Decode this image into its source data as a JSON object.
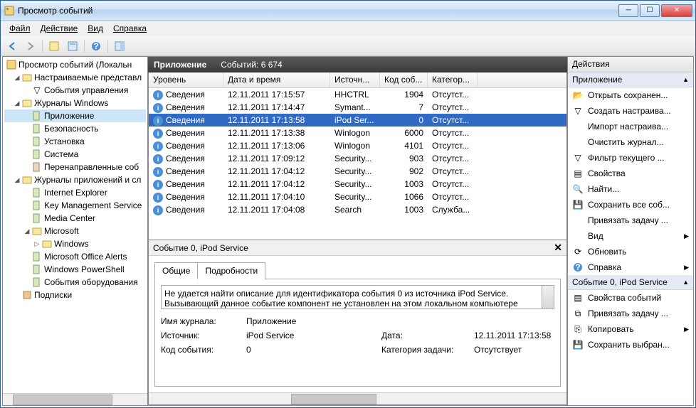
{
  "title": "Просмотр событий",
  "menu": {
    "file": "Файл",
    "action": "Действие",
    "view": "Вид",
    "help": "Справка"
  },
  "tree": {
    "root": "Просмотр событий (Локальн",
    "custom_views": "Настраиваемые представл",
    "admin_events": "События управления",
    "win_logs": "Журналы Windows",
    "application": "Приложение",
    "security": "Безопасность",
    "setup": "Установка",
    "system": "Система",
    "forwarded": "Перенаправленные соб",
    "app_logs": "Журналы приложений и сл",
    "ie": "Internet Explorer",
    "kms": "Key Management Service",
    "mc": "Media Center",
    "ms": "Microsoft",
    "windows": "Windows",
    "office": "Microsoft Office Alerts",
    "ps": "Windows PowerShell",
    "hw": "События оборудования",
    "subs": "Подписки"
  },
  "center": {
    "title": "Приложение",
    "count_label": "Событий: 6 674"
  },
  "columns": {
    "level": "Уровень",
    "date": "Дата и время",
    "source": "Источн...",
    "code": "Код соб...",
    "category": "Категор..."
  },
  "events": [
    {
      "level": "Сведения",
      "date": "12.11.2011 17:15:57",
      "src": "HHCTRL",
      "code": "1904",
      "cat": "Отсутст...",
      "sel": false
    },
    {
      "level": "Сведения",
      "date": "12.11.2011 17:14:47",
      "src": "Symant...",
      "code": "7",
      "cat": "Отсутст...",
      "sel": false
    },
    {
      "level": "Сведения",
      "date": "12.11.2011 17:13:58",
      "src": "iPod Ser...",
      "code": "0",
      "cat": "Отсутст...",
      "sel": true
    },
    {
      "level": "Сведения",
      "date": "12.11.2011 17:13:38",
      "src": "Winlogon",
      "code": "6000",
      "cat": "Отсутст...",
      "sel": false
    },
    {
      "level": "Сведения",
      "date": "12.11.2011 17:13:06",
      "src": "Winlogon",
      "code": "4101",
      "cat": "Отсутст...",
      "sel": false
    },
    {
      "level": "Сведения",
      "date": "12.11.2011 17:09:12",
      "src": "Security...",
      "code": "903",
      "cat": "Отсутст...",
      "sel": false
    },
    {
      "level": "Сведения",
      "date": "12.11.2011 17:04:12",
      "src": "Security...",
      "code": "902",
      "cat": "Отсутст...",
      "sel": false
    },
    {
      "level": "Сведения",
      "date": "12.11.2011 17:04:12",
      "src": "Security...",
      "code": "1003",
      "cat": "Отсутст...",
      "sel": false
    },
    {
      "level": "Сведения",
      "date": "12.11.2011 17:04:10",
      "src": "Security...",
      "code": "1066",
      "cat": "Отсутст...",
      "sel": false
    },
    {
      "level": "Сведения",
      "date": "12.11.2011 17:04:08",
      "src": "Search",
      "code": "1003",
      "cat": "Служба...",
      "sel": false
    }
  ],
  "detail": {
    "header": "Событие 0, iPod Service",
    "tab_general": "Общие",
    "tab_details": "Подробности",
    "description": "Не удается найти описание для идентификатора события 0 из источника iPod Service. Вызывающий данное событие компонент не установлен на этом локальном компьютере",
    "label_logname": "Имя журнала:",
    "val_logname": "Приложение",
    "label_source": "Источник:",
    "val_source": "iPod Service",
    "label_date": "Дата:",
    "val_date": "12.11.2011 17:13:58",
    "label_eventid": "Код события:",
    "val_eventid": "0",
    "label_taskcat": "Категория задачи:",
    "val_taskcat": "Отсутствует"
  },
  "actions": {
    "header": "Действия",
    "sec1": "Приложение",
    "open_saved": "Открыть сохранен...",
    "create_custom": "Создать настраива...",
    "import": "Импорт настраива...",
    "clear": "Очистить журнал...",
    "filter": "Фильтр текущего ...",
    "properties": "Свойства",
    "find": "Найти...",
    "save_all": "Сохранить все соб...",
    "attach_task1": "Привязать задачу ...",
    "view": "Вид",
    "refresh": "Обновить",
    "help": "Справка",
    "sec2": "Событие 0, iPod Service",
    "evt_props": "Свойства событий",
    "attach_task2": "Привязать задачу ...",
    "copy": "Копировать",
    "save_sel": "Сохранить выбран..."
  }
}
